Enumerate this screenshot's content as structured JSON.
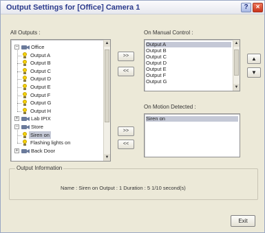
{
  "window": {
    "title": "Output Settings for [Office] Camera 1",
    "help_label": "?",
    "close_label": "×"
  },
  "all_outputs": {
    "label": "All Outputs :",
    "tree": [
      {
        "type": "camera",
        "label": "Office",
        "expander": "−"
      },
      {
        "type": "output",
        "label": "Output A"
      },
      {
        "type": "output",
        "label": "Output B"
      },
      {
        "type": "output",
        "label": "Output C"
      },
      {
        "type": "output",
        "label": "Output D"
      },
      {
        "type": "output",
        "label": "Output E"
      },
      {
        "type": "output",
        "label": "Output F"
      },
      {
        "type": "output",
        "label": "Output G"
      },
      {
        "type": "output",
        "label": "Output H"
      },
      {
        "type": "camera",
        "label": "Lab IPIX",
        "expander": "+"
      },
      {
        "type": "camera",
        "label": "Store",
        "expander": "−"
      },
      {
        "type": "output",
        "label": "Siren on",
        "selected": true
      },
      {
        "type": "output",
        "label": "Flashing lights on"
      },
      {
        "type": "camera",
        "label": "Back Door",
        "expander": "+"
      }
    ]
  },
  "transfer_buttons": {
    "add_manual": ">>",
    "remove_manual": "<<",
    "add_motion": ">>",
    "remove_motion": "<<"
  },
  "manual_control": {
    "label": "On Manual Control :",
    "items": [
      "Output A",
      "Output B",
      "Output C",
      "Output D",
      "Output E",
      "Output F",
      "Output G"
    ],
    "selected_index": 0,
    "move_up": "▲",
    "move_down": "▼"
  },
  "motion_detected": {
    "label": "On Motion Detected :",
    "items": [
      "Siren on"
    ],
    "selected_index": 0
  },
  "output_info": {
    "title": "Output Information",
    "text": "Name : Siren on   Output : 1   Duration : 5 1/10 second(s)"
  },
  "exit_label": "Exit",
  "colors": {
    "dialog_bg": "#ece9d8",
    "title_text": "#2b3a8c",
    "selection": "#c4c8d6",
    "close_button": "#c9331a"
  }
}
